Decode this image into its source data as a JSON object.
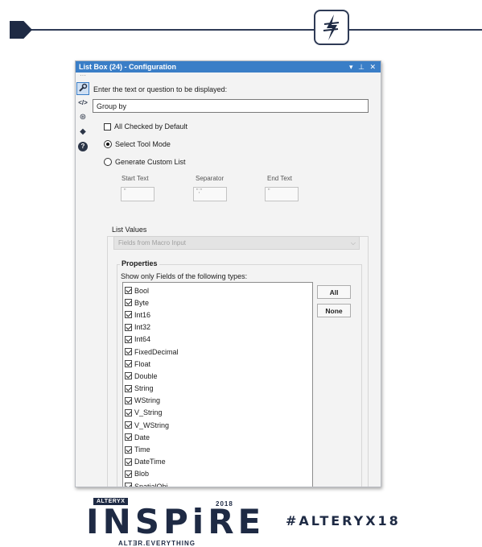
{
  "window": {
    "title": "List Box (24) - Configuration",
    "controls": {
      "dropdown": "▾",
      "pin": "⊥",
      "close": "✕"
    }
  },
  "sidebar": {
    "dots": "···",
    "items": [
      {
        "icon": "wrench-icon",
        "glyph": "🔧"
      },
      {
        "icon": "code-icon",
        "glyph": "</>"
      },
      {
        "icon": "gear-check-icon",
        "glyph": "⊛"
      },
      {
        "icon": "tag-icon",
        "glyph": "◆"
      },
      {
        "icon": "help-icon",
        "glyph": "?"
      }
    ]
  },
  "form": {
    "prompt_label": "Enter the text or question to be displayed:",
    "prompt_value": "Group by",
    "all_checked_label": "All Checked by Default",
    "select_tool_mode_label": "Select Tool Mode",
    "generate_custom_list_label": "Generate Custom List",
    "start_text_label": "Start Text",
    "separator_label": "Separator",
    "end_text_label": "End Text",
    "start_text_value": "\"",
    "separator_value": "\",\"",
    "end_text_value": "\""
  },
  "list_values": {
    "label": "List Values",
    "source_selected": "Fields from Macro Input",
    "properties_label": "Properties",
    "types_label": "Show only Fields of the following types:",
    "types": [
      "Bool",
      "Byte",
      "Int16",
      "Int32",
      "Int64",
      "FixedDecimal",
      "Float",
      "Double",
      "String",
      "WString",
      "V_String",
      "V_WString",
      "Date",
      "Time",
      "DateTime",
      "Blob",
      "SpatialObj"
    ],
    "all_button": "All",
    "none_button": "None"
  },
  "branding": {
    "tag": "ALTERYX",
    "year": "2018",
    "word": "INSPiRE",
    "sub": "ALTƎR.EVERYTHING",
    "hashtag": "#ALTERYX18"
  },
  "colors": {
    "titlebar": "#3a7ec7",
    "brand": "#1e2a44",
    "connector": "#2f3b56"
  }
}
